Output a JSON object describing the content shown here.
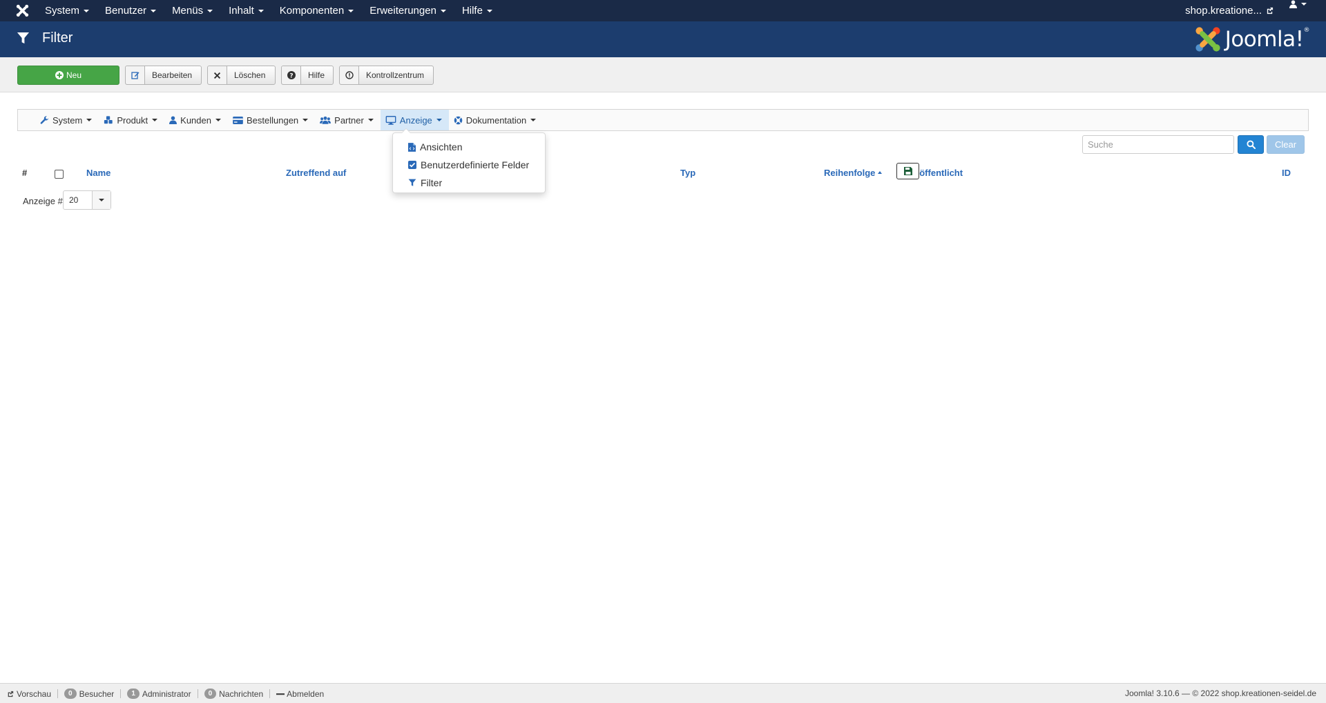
{
  "topnav": {
    "items": [
      "System",
      "Benutzer",
      "Menüs",
      "Inhalt",
      "Komponenten",
      "Erweiterungen",
      "Hilfe"
    ],
    "site_link": "shop.kreatione...",
    "user_icon": "user-icon"
  },
  "header": {
    "title": "Filter",
    "icon": "filter-icon",
    "brand": "Joomla!"
  },
  "toolbar": {
    "new_label": "Neu",
    "edit_label": "Bearbeiten",
    "delete_label": "Löschen",
    "help_label": "Hilfe",
    "cpanel_label": "Kontrollzentrum"
  },
  "submenu": {
    "items": [
      {
        "label": "System",
        "icon": "wrench-icon"
      },
      {
        "label": "Produkt",
        "icon": "cubes-icon"
      },
      {
        "label": "Kunden",
        "icon": "user-icon"
      },
      {
        "label": "Bestellungen",
        "icon": "credit-card-icon"
      },
      {
        "label": "Partner",
        "icon": "users-icon"
      },
      {
        "label": "Anzeige",
        "icon": "monitor-icon",
        "active": true
      },
      {
        "label": "Dokumentation",
        "icon": "lifebuoy-icon"
      }
    ]
  },
  "dropdown": {
    "items": [
      {
        "label": "Ansichten",
        "icon": "file-code-icon"
      },
      {
        "label": "Benutzerdefinierte Felder",
        "icon": "checkbox-icon"
      },
      {
        "label": "Filter",
        "icon": "filter-icon"
      }
    ]
  },
  "search": {
    "placeholder": "Suche",
    "clear_label": "Clear"
  },
  "table": {
    "headers": {
      "hash": "#",
      "name": "Name",
      "applies_to": "Zutreffend auf",
      "type": "Typ",
      "order": "Reihenfolge",
      "published": "Veröffentlicht",
      "id": "ID"
    }
  },
  "pagination": {
    "limit_label": "Anzeige #",
    "limit_value": "20"
  },
  "statusbar": {
    "preview": "Vorschau",
    "visitors_count": "0",
    "visitors_label": "Besucher",
    "admins_count": "1",
    "admins_label": "Administrator",
    "messages_count": "0",
    "messages_label": "Nachrichten",
    "logout": "Abmelden",
    "version_info": "Joomla! 3.10.6 — © 2022 shop.kreationen-seidel.de"
  },
  "colors": {
    "topbar": "#1a2a47",
    "header": "#1c3d6e",
    "new_button": "#46a546",
    "link": "#2a69b8",
    "search_button": "#2384d3"
  }
}
